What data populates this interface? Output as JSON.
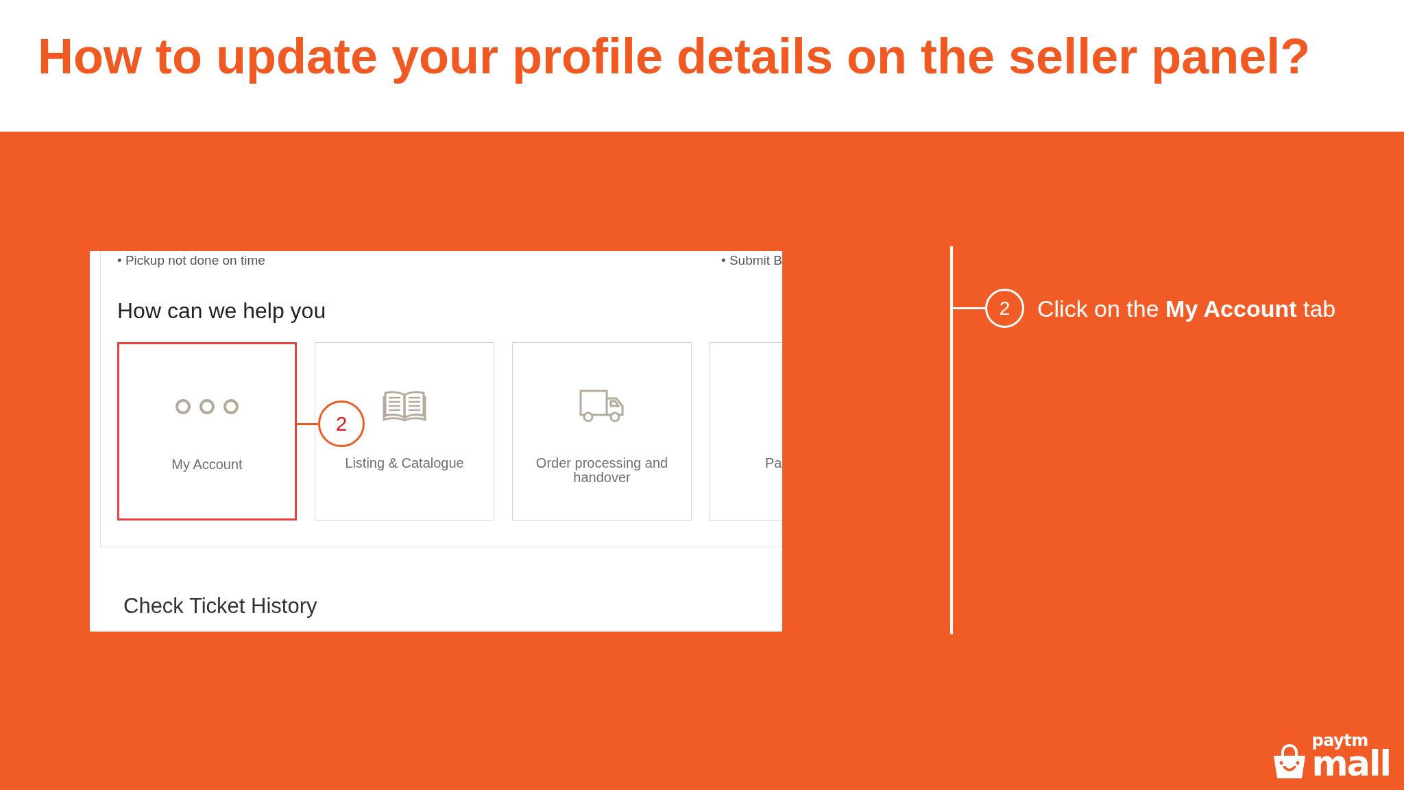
{
  "slide": {
    "title": "How to update your profile details on the seller panel?"
  },
  "screenshot": {
    "bullets": [
      "• Pickup not done on time",
      "• Submit B"
    ],
    "heading": "How can we help you",
    "cards": [
      {
        "kind": "account",
        "label": "My Account",
        "highlighted": true
      },
      {
        "kind": "listing",
        "label": "Listing & Catalogue",
        "highlighted": false
      },
      {
        "kind": "order",
        "label": "Order processing and handover",
        "highlighted": false
      },
      {
        "kind": "partial",
        "label": "Pa",
        "highlighted": false
      }
    ],
    "annotation": {
      "number": "2"
    },
    "link": "Check Ticket History"
  },
  "callout": {
    "number": "2",
    "text": "Click on the **My Account** tab"
  },
  "logo": {
    "line_1": "paytm",
    "line_2": "mall"
  }
}
